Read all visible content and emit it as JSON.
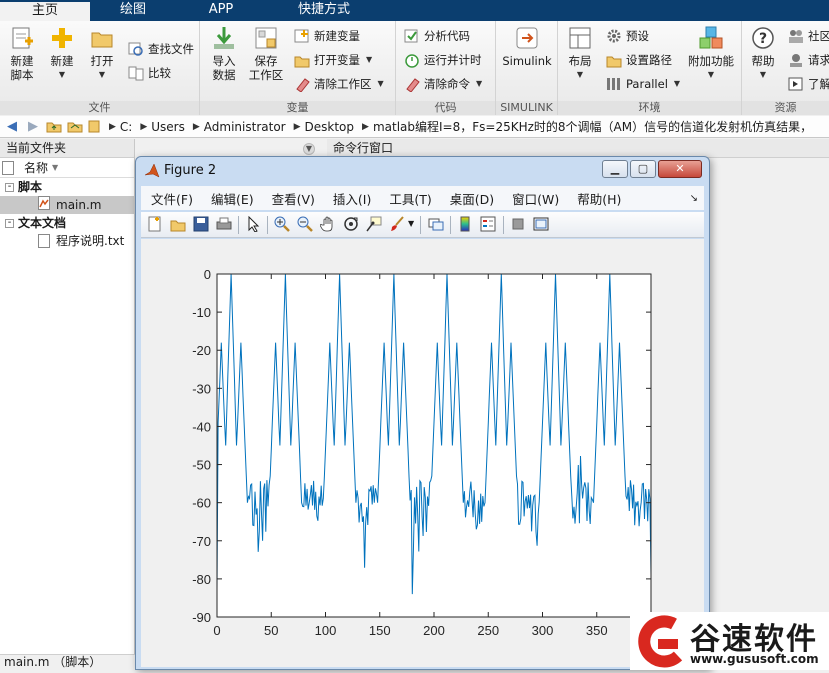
{
  "tabs": [
    {
      "label": "主页"
    },
    {
      "label": "绘图"
    },
    {
      "label": "APP"
    },
    {
      "label": "快捷方式"
    }
  ],
  "ribbon": {
    "file_group": {
      "label": "文件",
      "new_script": "新建\n脚本",
      "new": "新建",
      "open": "打开",
      "find_files": "查找文件",
      "compare": "比较"
    },
    "variable_group": {
      "label": "变量",
      "import_data": "导入\n数据",
      "save_workspace": "保存\n工作区",
      "new_variable": "新建变量",
      "open_variable": "打开变量",
      "clear_workspace": "清除工作区"
    },
    "code_group": {
      "label": "代码",
      "analyze_code": "分析代码",
      "run_and_time": "运行并计时",
      "clear_commands": "清除命令"
    },
    "simulink_group": {
      "label": "SIMULINK",
      "simulink": "Simulink"
    },
    "environment_group": {
      "label": "环境",
      "layout": "布局",
      "preferences": "预设",
      "set_path": "设置路径",
      "parallel": "Parallel",
      "addons": "附加功能"
    },
    "resources_group": {
      "label": "资源",
      "help": "帮助",
      "community": "社区",
      "request_support": "请求",
      "learn_matlab": "了解"
    }
  },
  "address_bar": {
    "crumbs": [
      "C:",
      "Users",
      "Administrator",
      "Desktop",
      "matlab编程I=8，Fs=25KHz时的8个调幅（AM）信号的信道化发射机仿真结果，"
    ]
  },
  "current_folder": {
    "title": "当前文件夹",
    "column_name": "名称",
    "groups": [
      {
        "label": "脚本",
        "items": [
          "main.m"
        ]
      },
      {
        "label": "文本文档",
        "items": [
          "程序说明.txt"
        ]
      }
    ]
  },
  "command_window": {
    "title": "命令行窗口"
  },
  "status_bar": {
    "text": "main.m （脚本）"
  },
  "figure": {
    "title": "Figure 2",
    "menus": [
      "文件(F)",
      "编辑(E)",
      "查看(V)",
      "插入(I)",
      "工具(T)",
      "桌面(D)",
      "窗口(W)",
      "帮助(H)"
    ]
  },
  "chart_data": {
    "type": "line",
    "title": "",
    "xlabel": "",
    "ylabel": "",
    "xlim": [
      0,
      400
    ],
    "ylim": [
      -90,
      0
    ],
    "xticks": [
      0,
      50,
      100,
      150,
      200,
      250,
      300,
      350,
      400
    ],
    "yticks": [
      0,
      -10,
      -20,
      -30,
      -40,
      -50,
      -60,
      -70,
      -80,
      -90
    ],
    "series_color": "#0072bd",
    "peaks": [
      {
        "x": 13,
        "y": 0
      },
      {
        "x": 63,
        "y": 0
      },
      {
        "x": 113,
        "y": 0
      },
      {
        "x": 163,
        "y": 0
      },
      {
        "x": 212,
        "y": 0
      },
      {
        "x": 262,
        "y": 0
      },
      {
        "x": 312,
        "y": 0
      },
      {
        "x": 362,
        "y": 0
      }
    ],
    "noise_floor": -60,
    "min_value": -84
  },
  "watermark": {
    "text": "谷速软件",
    "url": "www.gususoft.com"
  }
}
